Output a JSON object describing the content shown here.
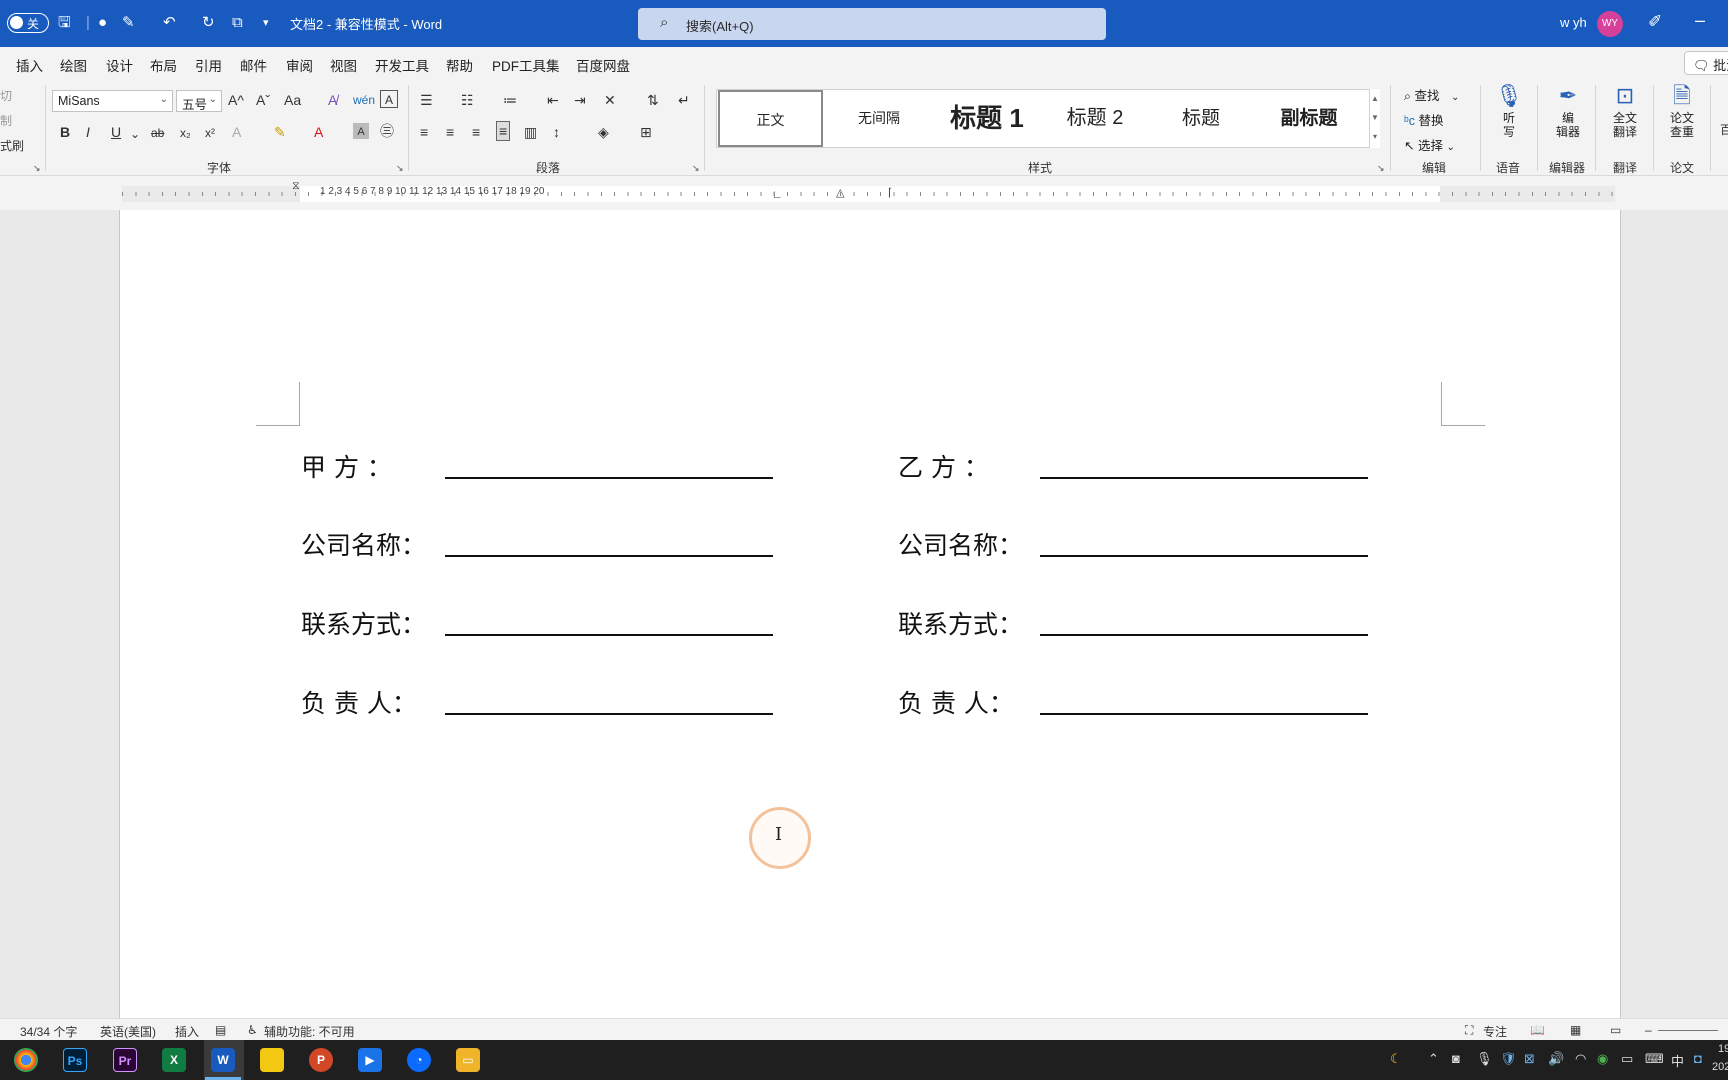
{
  "titlebar": {
    "autosave": "关",
    "doc_title": "文档2  -  兼容性模式  -  Word",
    "search_placeholder": "搜索(Alt+Q)",
    "user_name": "w yh",
    "avatar_initials": "WY"
  },
  "menu": {
    "tabs": [
      "插入",
      "绘图",
      "设计",
      "布局",
      "引用",
      "邮件",
      "审阅",
      "视图",
      "开发工具",
      "帮助",
      "PDF工具集",
      "百度网盘"
    ],
    "comment_button": "批注"
  },
  "ribbon": {
    "clipboard": {
      "cut": "切",
      "copy": "制",
      "format_painter": "式刷"
    },
    "font": {
      "name": "MiSans",
      "size": "五号",
      "label": "字体",
      "bold": "B",
      "italic": "I",
      "underline": "U",
      "strikethrough": "ab",
      "subscript": "x₂",
      "superscript": "x²",
      "change_case": "Aa",
      "grow": "A^",
      "shrink": "Aˇ",
      "phonetic": "wén"
    },
    "paragraph": {
      "label": "段落"
    },
    "styles": {
      "label": "样式",
      "items": [
        "正文",
        "无间隔",
        "标题 1",
        "标题 2",
        "标题",
        "副标题"
      ]
    },
    "editing": {
      "find": "查找",
      "replace": "替换",
      "select": "选择",
      "label": "编辑"
    },
    "voice": {
      "dictate_line1": "听",
      "dictate_line2": "写",
      "label": "语音"
    },
    "editor": {
      "line1": "编",
      "line2": "辑器",
      "label": "编辑器"
    },
    "translate": {
      "line1": "全文",
      "line2": "翻译",
      "label": "翻译"
    },
    "paper": {
      "line1": "论文",
      "line2": "查重",
      "label": "论文"
    },
    "overflow": "百"
  },
  "ruler": {
    "numbers": "1   2   3   4   5   6   7   8   9  10  11  12  13  14  15  16  17  18  19  20"
  },
  "document": {
    "left_fields": [
      "甲    方  ：",
      "公司名称：",
      "联系方式：",
      "负  责  人："
    ],
    "right_fields": [
      "乙    方  ：",
      "公司名称：",
      "联系方式：",
      "负  责  人："
    ]
  },
  "statusbar": {
    "word_count": "34/34 个字",
    "language": "英语(美国)",
    "insert_mode": "插入",
    "accessibility": "辅助功能: 不可用",
    "focus": "专注"
  },
  "taskbar": {
    "apps": [
      "chrome",
      "photoshop",
      "premiere",
      "excel",
      "word",
      "powerbi",
      "powerpoint",
      "meeting",
      "browser",
      "file-explorer"
    ],
    "ps": "Ps",
    "pr": "Pr",
    "x": "X",
    "w": "W",
    "p": "P",
    "ime": "中",
    "clock_partial": "19",
    "date_partial": "202"
  }
}
